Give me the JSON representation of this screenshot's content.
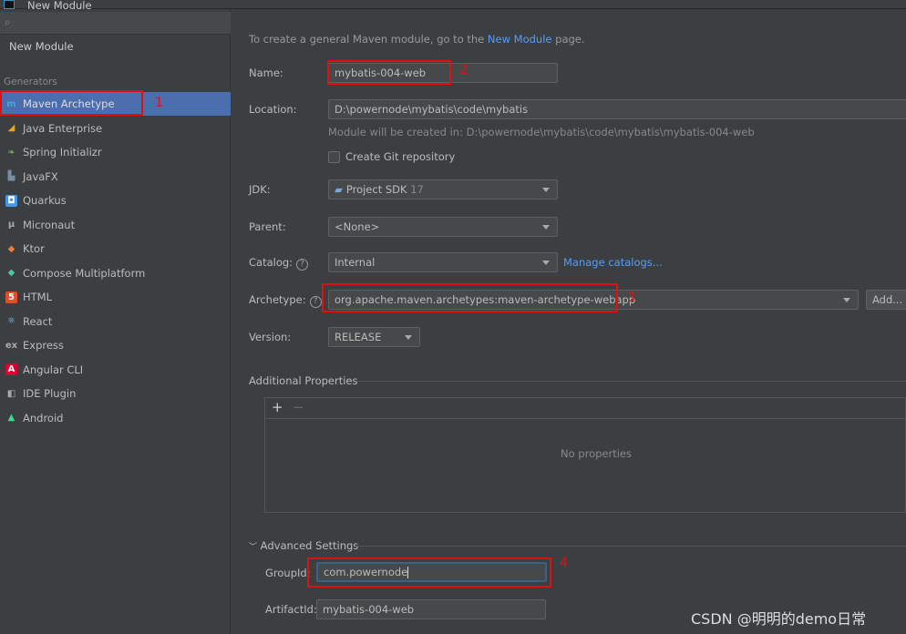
{
  "window": {
    "title": "New Module"
  },
  "sidebar": {
    "top_item": "New Module",
    "section": "Generators",
    "items": [
      {
        "label": "Maven Archetype",
        "icon": "maven-icon"
      },
      {
        "label": "Java Enterprise",
        "icon": "java-enterprise-icon"
      },
      {
        "label": "Spring Initializr",
        "icon": "spring-icon"
      },
      {
        "label": "JavaFX",
        "icon": "javafx-icon"
      },
      {
        "label": "Quarkus",
        "icon": "quarkus-icon"
      },
      {
        "label": "Micronaut",
        "icon": "micronaut-icon"
      },
      {
        "label": "Ktor",
        "icon": "ktor-icon"
      },
      {
        "label": "Compose Multiplatform",
        "icon": "compose-icon"
      },
      {
        "label": "HTML",
        "icon": "html-icon"
      },
      {
        "label": "React",
        "icon": "react-icon"
      },
      {
        "label": "Express",
        "icon": "express-icon"
      },
      {
        "label": "Angular CLI",
        "icon": "angular-icon"
      },
      {
        "label": "IDE Plugin",
        "icon": "plugin-icon"
      },
      {
        "label": "Android",
        "icon": "android-icon"
      }
    ]
  },
  "main": {
    "info_prefix": "To create a general Maven module, go to the ",
    "info_link": "New Module",
    "info_suffix": " page.",
    "name_label": "Name:",
    "name_value": "mybatis-004-web",
    "location_label": "Location:",
    "location_value": "D:\\powernode\\mybatis\\code\\mybatis",
    "module_hint": "Module will be created in: D:\\powernode\\mybatis\\code\\mybatis\\mybatis-004-web",
    "git_label": "Create Git repository",
    "jdk_label": "JDK:",
    "jdk_value": "Project SDK",
    "jdk_version": "17",
    "parent_label": "Parent:",
    "parent_value": "<None>",
    "catalog_label": "Catalog:",
    "catalog_value": "Internal",
    "manage_catalogs": "Manage catalogs...",
    "archetype_label": "Archetype:",
    "archetype_value": "org.apache.maven.archetypes:maven-archetype-webapp",
    "add_button": "Add...",
    "version_label": "Version:",
    "version_value": "RELEASE",
    "help_glyph": "?",
    "additional_properties": "Additional Properties",
    "add_glyph": "+",
    "remove_glyph": "−",
    "no_properties": "No properties",
    "advanced_settings": "Advanced Settings",
    "groupid_label": "GroupId:",
    "groupid_value": "com.powernode",
    "artifactid_label": "ArtifactId:",
    "artifactid_value": "mybatis-004-web"
  },
  "annotations": [
    "1",
    "2",
    "3",
    "4"
  ],
  "watermark": "CSDN @明明的demo日常"
}
